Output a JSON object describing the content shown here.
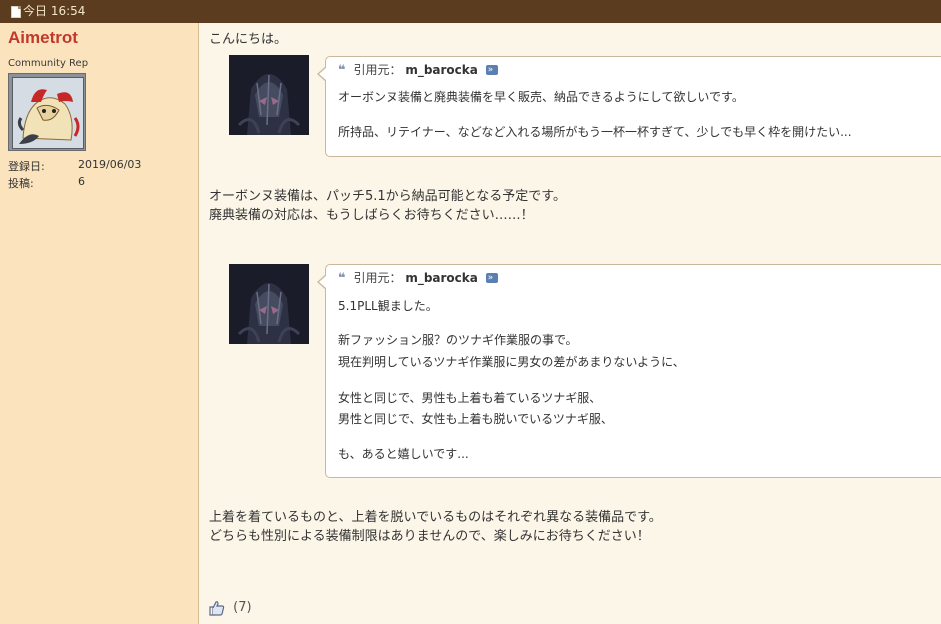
{
  "header": {
    "date_label": "今日 16:54"
  },
  "user": {
    "name": "Aimetrot",
    "title": "Community Rep",
    "stats": [
      {
        "label": "登録日:",
        "value": "2019/06/03"
      },
      {
        "label": "投稿:",
        "value": "6"
      }
    ]
  },
  "post": {
    "greeting": "こんにちは。",
    "quote1": {
      "label": "引用元：",
      "author": "m_barocka",
      "lines": [
        "オーボンヌ装備と廃典装備を早く販売、納品できるようにして欲しいです。",
        "所持品、リテイナー、などなど入れる場所がもう一杯一杯すぎて、少しでも早く枠を開けたい..."
      ]
    },
    "reply1": [
      "オーボンヌ装備は、パッチ5.1から納品可能となる予定です。",
      "廃典装備の対応は、もうしばらくお待ちください……！"
    ],
    "quote2": {
      "label": "引用元：",
      "author": "m_barocka",
      "lines": [
        "5.1PLL観ました。",
        "新ファッション服？のツナギ作業服の事で。",
        "現在判明しているツナギ作業服に男女の差があまりないように、",
        "女性と同じで、男性も上着も着ているツナギ服、",
        "男性と同じで、女性も上着も脱いでいるツナギ服、",
        "も、あると嬉しいです..."
      ]
    },
    "reply2": [
      "上着を着ているものと、上着を脱いでいるものはそれぞれ異なる装備品です。",
      "どちらも性別による装備制限はありませんので、楽しみにお待ちください！"
    ],
    "likes": "(7)"
  },
  "colors": {
    "header_bg": "#5b3c1f",
    "sidebar_bg": "#fbe4bd",
    "content_bg": "#fcf6e9",
    "username": "#c0392b"
  }
}
